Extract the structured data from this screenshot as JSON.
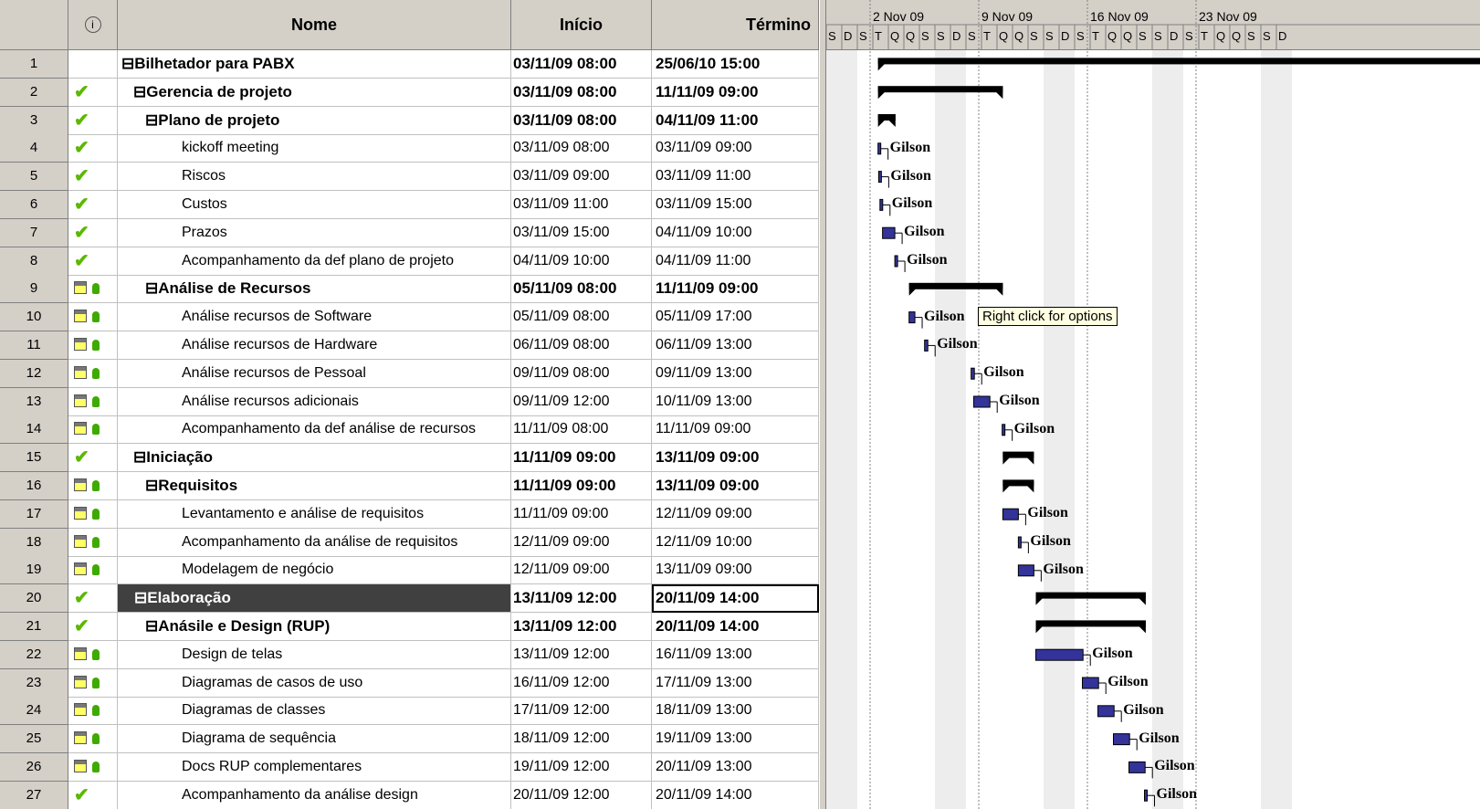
{
  "columns": {
    "info_icon": "info-icon",
    "name": "Nome",
    "start": "Início",
    "end": "Término"
  },
  "timescale": {
    "weeks": [
      "2 Nov 09",
      "9 Nov 09",
      "16 Nov 09",
      "23 Nov 09"
    ],
    "days": [
      "S",
      "D",
      "S",
      "T",
      "Q",
      "Q",
      "S",
      "S",
      "D",
      "S",
      "T",
      "Q",
      "Q",
      "S",
      "S",
      "D",
      "S",
      "T",
      "Q",
      "Q",
      "S",
      "S",
      "D",
      "S",
      "T",
      "Q",
      "Q",
      "S",
      "S",
      "D"
    ]
  },
  "tooltip": "Right click for options",
  "resource_name": "Gilson",
  "colors": {
    "summary_bar": "#000000",
    "task_bar": "#333399",
    "check": "#5cb800",
    "selection": "#404040"
  },
  "tasks": [
    {
      "id": "1",
      "indicator": "none",
      "level": 0,
      "summary": true,
      "name": "⊟Bilhetador para PABX",
      "start": "03/11/09 08:00",
      "end": "25/06/10 15:00"
    },
    {
      "id": "2",
      "indicator": "check",
      "level": 1,
      "summary": true,
      "name": "⊟Gerencia de projeto",
      "start": "03/11/09 08:00",
      "end": "11/11/09 09:00"
    },
    {
      "id": "3",
      "indicator": "check",
      "level": 2,
      "summary": true,
      "name": "⊟Plano de projeto",
      "start": "03/11/09 08:00",
      "end": "04/11/09 11:00"
    },
    {
      "id": "4",
      "indicator": "check",
      "level": 3,
      "summary": false,
      "name": "kickoff meeting",
      "start": "03/11/09 08:00",
      "end": "03/11/09 09:00"
    },
    {
      "id": "5",
      "indicator": "check",
      "level": 3,
      "summary": false,
      "name": "Riscos",
      "start": "03/11/09 09:00",
      "end": "03/11/09 11:00"
    },
    {
      "id": "6",
      "indicator": "check",
      "level": 3,
      "summary": false,
      "name": "Custos",
      "start": "03/11/09 11:00",
      "end": "03/11/09 15:00"
    },
    {
      "id": "7",
      "indicator": "check",
      "level": 3,
      "summary": false,
      "name": "Prazos",
      "start": "03/11/09 15:00",
      "end": "04/11/09 10:00"
    },
    {
      "id": "8",
      "indicator": "check",
      "level": 3,
      "summary": false,
      "name": "Acompanhamento da def plano de projeto",
      "start": "04/11/09 10:00",
      "end": "04/11/09 11:00"
    },
    {
      "id": "9",
      "indicator": "calendar",
      "level": 2,
      "summary": true,
      "name": "⊟Análise de Recursos",
      "start": "05/11/09 08:00",
      "end": "11/11/09 09:00"
    },
    {
      "id": "10",
      "indicator": "calendar",
      "level": 3,
      "summary": false,
      "name": "Análise recursos de Software",
      "start": "05/11/09 08:00",
      "end": "05/11/09 17:00"
    },
    {
      "id": "11",
      "indicator": "calendar",
      "level": 3,
      "summary": false,
      "name": "Análise recursos de Hardware",
      "start": "06/11/09 08:00",
      "end": "06/11/09 13:00"
    },
    {
      "id": "12",
      "indicator": "calendar",
      "level": 3,
      "summary": false,
      "name": "Análise recursos de Pessoal",
      "start": "09/11/09 08:00",
      "end": "09/11/09 13:00"
    },
    {
      "id": "13",
      "indicator": "calendar",
      "level": 3,
      "summary": false,
      "name": "Análise recursos adicionais",
      "start": "09/11/09 12:00",
      "end": "10/11/09 13:00"
    },
    {
      "id": "14",
      "indicator": "calendar",
      "level": 3,
      "summary": false,
      "name": "Acompanhamento da def análise de recursos",
      "start": "11/11/09 08:00",
      "end": "11/11/09 09:00"
    },
    {
      "id": "15",
      "indicator": "check",
      "level": 1,
      "summary": true,
      "name": "⊟Iniciação",
      "start": "11/11/09 09:00",
      "end": "13/11/09 09:00"
    },
    {
      "id": "16",
      "indicator": "calendar",
      "level": 2,
      "summary": true,
      "name": "⊟Requisitos",
      "start": "11/11/09 09:00",
      "end": "13/11/09 09:00"
    },
    {
      "id": "17",
      "indicator": "calendar",
      "level": 3,
      "summary": false,
      "name": "Levantamento e análise de requisitos",
      "start": "11/11/09 09:00",
      "end": "12/11/09 09:00"
    },
    {
      "id": "18",
      "indicator": "calendar",
      "level": 3,
      "summary": false,
      "name": "Acompanhamento da análise de requisitos",
      "start": "12/11/09 09:00",
      "end": "12/11/09 10:00"
    },
    {
      "id": "19",
      "indicator": "calendar",
      "level": 3,
      "summary": false,
      "name": "Modelagem de negócio",
      "start": "12/11/09 09:00",
      "end": "13/11/09 09:00"
    },
    {
      "id": "20",
      "indicator": "check",
      "level": 1,
      "summary": true,
      "selected": true,
      "name": "⊟Elaboração",
      "start": "13/11/09 12:00",
      "end": "20/11/09 14:00"
    },
    {
      "id": "21",
      "indicator": "check",
      "level": 2,
      "summary": true,
      "name": "⊟Anásile e Design (RUP)",
      "start": "13/11/09 12:00",
      "end": "20/11/09 14:00"
    },
    {
      "id": "22",
      "indicator": "calendar",
      "level": 3,
      "summary": false,
      "name": "Design de telas",
      "start": "13/11/09 12:00",
      "end": "16/11/09 13:00"
    },
    {
      "id": "23",
      "indicator": "calendar",
      "level": 3,
      "summary": false,
      "name": "Diagramas de casos de uso",
      "start": "16/11/09 12:00",
      "end": "17/11/09 13:00"
    },
    {
      "id": "24",
      "indicator": "calendar",
      "level": 3,
      "summary": false,
      "name": "Diagramas de classes",
      "start": "17/11/09 12:00",
      "end": "18/11/09 13:00"
    },
    {
      "id": "25",
      "indicator": "calendar",
      "level": 3,
      "summary": false,
      "name": "Diagrama de sequência",
      "start": "18/11/09 12:00",
      "end": "19/11/09 13:00"
    },
    {
      "id": "26",
      "indicator": "calendar",
      "level": 3,
      "summary": false,
      "name": "Docs RUP complementares",
      "start": "19/11/09 12:00",
      "end": "20/11/09 13:00"
    },
    {
      "id": "27",
      "indicator": "check",
      "level": 3,
      "summary": false,
      "name": "Acompanhamento da análise design",
      "start": "20/11/09 12:00",
      "end": "20/11/09 14:00"
    }
  ]
}
